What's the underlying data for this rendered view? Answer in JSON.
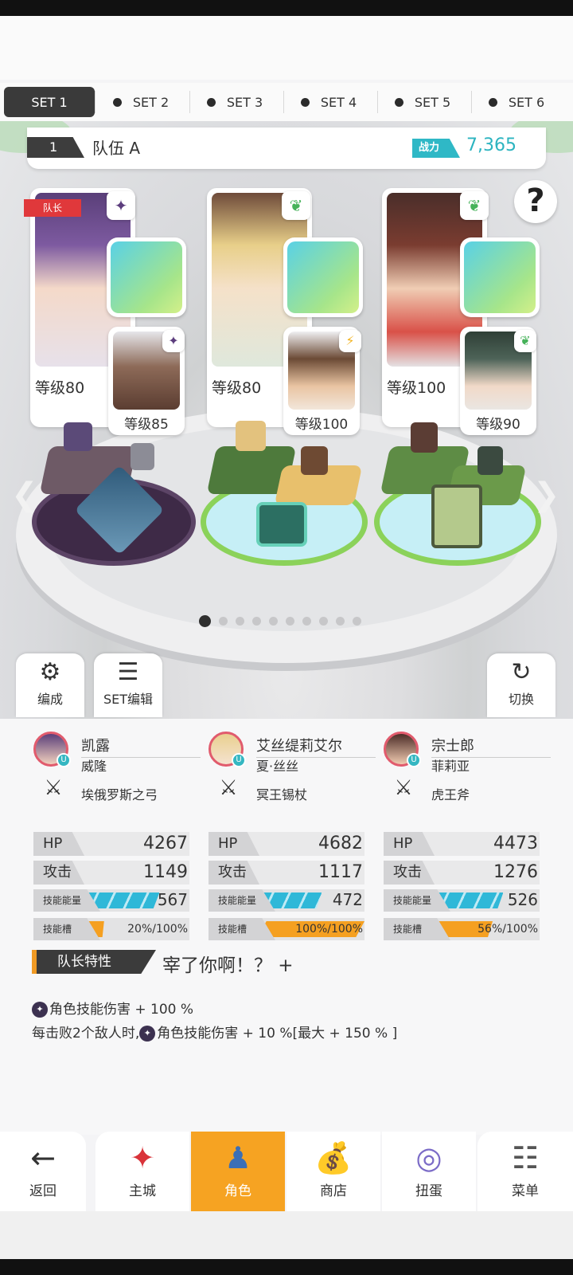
{
  "set_tabs": [
    "SET 1",
    "SET 2",
    "SET 3",
    "SET 4",
    "SET 5",
    "SET 6"
  ],
  "team": {
    "number": "1",
    "name": "队伍 A",
    "power_label": "战力",
    "power_value": "7,365"
  },
  "help_label": "?",
  "captain_tag": "队长",
  "cards": [
    {
      "level": "等级80",
      "sub_level": "等级85",
      "element": "dark",
      "element_icon": "✦"
    },
    {
      "level": "等级80",
      "sub_level": "等级100",
      "element": "earth",
      "element_icon": "❦"
    },
    {
      "level": "等级100",
      "sub_level": "等级90",
      "element": "earth",
      "element_icon": "❦"
    }
  ],
  "sub_element_icons": [
    "✦",
    "⚡",
    "❦"
  ],
  "side_buttons": {
    "formation": "编成",
    "set_edit": "SET编辑",
    "switch": "切换"
  },
  "characters": [
    {
      "name": "凯露",
      "partner": "威隆",
      "weapon": "埃俄罗斯之弓",
      "hp_label": "HP",
      "hp": "4267",
      "atk_label": "攻击",
      "atk": "1149",
      "energy_label": "技能能量",
      "energy": "567",
      "energy_fill": 0.72,
      "slot_label": "技能槽",
      "slot": "20%/100%",
      "slot_fill": 0.2
    },
    {
      "name": "艾丝缇莉艾尔",
      "partner": "夏·丝丝",
      "weapon": "冥王锡杖",
      "hp_label": "HP",
      "hp": "4682",
      "atk_label": "攻击",
      "atk": "1117",
      "energy_label": "技能能量",
      "energy": "472",
      "energy_fill": 0.6,
      "slot_label": "技能槽",
      "slot": "100%/100%",
      "slot_fill": 1.0
    },
    {
      "name": "宗士郎",
      "partner": "菲莉亚",
      "weapon": "虎王斧",
      "hp_label": "HP",
      "hp": "4473",
      "atk_label": "攻击",
      "atk": "1276",
      "energy_label": "技能能量",
      "energy": "526",
      "energy_fill": 0.66,
      "slot_label": "技能槽",
      "slot": "56%/100%",
      "slot_fill": 0.56
    }
  ],
  "leader": {
    "label": "队长特性",
    "name": "宰了你啊！？ +",
    "line1": "角色技能伤害 + 100 %",
    "line2_prefix": "每击败2个敌人时,",
    "line2": "角色技能伤害 + 10 %[最大 + 150 % ]"
  },
  "nav": {
    "back": "返回",
    "city": "主城",
    "character": "角色",
    "shop": "商店",
    "gacha": "扭蛋",
    "menu": "菜单"
  },
  "page_dots": {
    "count": 10,
    "active": 1
  },
  "colors": {
    "accent_orange": "#f6a322",
    "energy_cyan": "#2fb8d8",
    "slot_orange": "#f5a021",
    "power_teal": "#2cb4c0"
  }
}
